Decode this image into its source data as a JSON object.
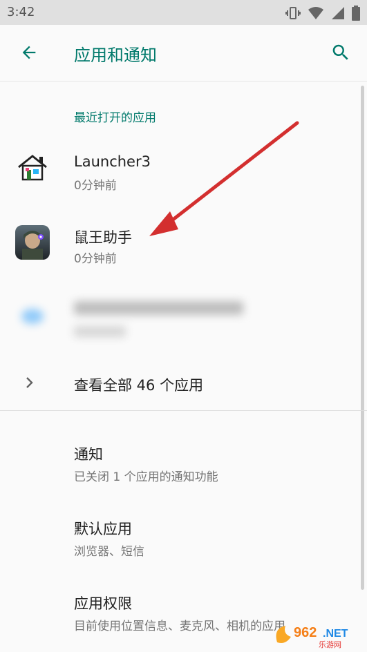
{
  "status_bar": {
    "time": "3:42",
    "icons": [
      "vibrate-icon",
      "wifi-icon",
      "signal-icon",
      "battery-icon"
    ]
  },
  "app_bar": {
    "title": "应用和通知",
    "back_icon": "arrow-left-icon",
    "search_icon": "search-icon",
    "accent_color": "#00796b"
  },
  "recent_apps": {
    "header": "最近打开的应用",
    "items": [
      {
        "name": "Launcher3",
        "time": "0分钟前",
        "icon": "launcher3-icon"
      },
      {
        "name": "鼠王助手",
        "time": "0分钟前",
        "icon": "shuwang-app-icon"
      },
      {
        "name": "",
        "time": "",
        "icon": "blurred-app-icon",
        "blurred": true
      }
    ]
  },
  "see_all": {
    "label": "查看全部 46 个应用",
    "icon": "chevron-right-icon"
  },
  "preferences": [
    {
      "title": "通知",
      "subtitle": "已关闭 1 个应用的通知功能"
    },
    {
      "title": "默认应用",
      "subtitle": "浏览器、短信"
    },
    {
      "title": "应用权限",
      "subtitle": "目前使用位置信息、麦克风、相机的应用"
    }
  ],
  "watermark": {
    "text": "962.NET",
    "subtext": "乐游网"
  },
  "annotation": {
    "color": "#d32f2f"
  }
}
